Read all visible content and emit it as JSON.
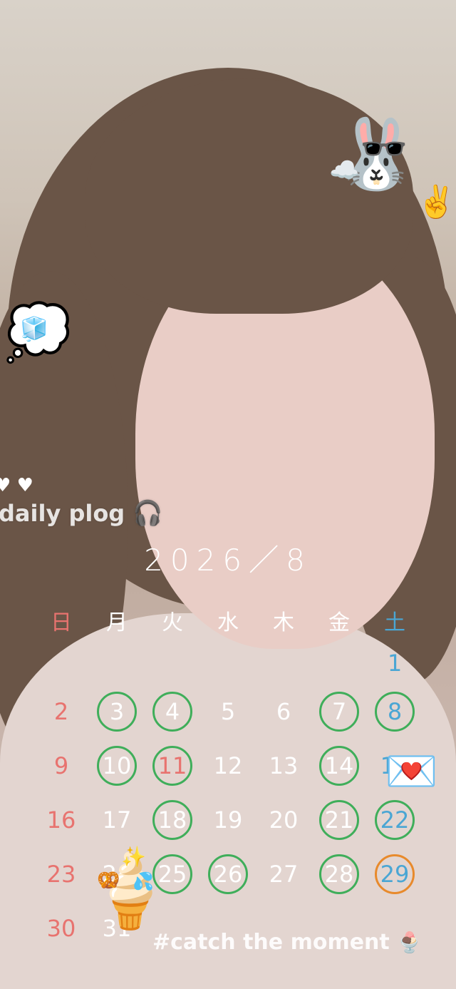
{
  "overlay_text": {
    "plog_label": "daily plog",
    "hashtag": "#catch the moment"
  },
  "calendar": {
    "title": "2026／8",
    "weekdays": [
      "日",
      "月",
      "火",
      "水",
      "木",
      "金",
      "土"
    ],
    "weeks": [
      [
        null,
        null,
        null,
        null,
        null,
        null,
        "1"
      ],
      [
        "2",
        "3",
        "4",
        "5",
        "6",
        "7",
        "8"
      ],
      [
        "9",
        "10",
        "11",
        "12",
        "13",
        "14",
        "15"
      ],
      [
        "16",
        "17",
        "18",
        "19",
        "20",
        "21",
        "22"
      ],
      [
        "23",
        "24",
        "25",
        "26",
        "27",
        "28",
        "29"
      ],
      [
        "30",
        "31",
        null,
        null,
        null,
        null,
        null
      ]
    ],
    "green_circled": [
      "3",
      "4",
      "7",
      "8",
      "10",
      "11",
      "14",
      "18",
      "21",
      "22",
      "25",
      "26",
      "28"
    ],
    "orange_circled": [
      "29"
    ],
    "red_text": [
      "11"
    ],
    "colors": {
      "sunday": "#e8736f",
      "saturday": "#4aa6d4",
      "ring_green": "#3fae5a",
      "ring_orange": "#e88a2c"
    }
  },
  "stickers": [
    "bunny-sunglasses-sticker",
    "thought-bubble-ice-sticker",
    "hearts-sticker",
    "headphones-icon",
    "love-letter-sticker",
    "soft-serve-sticker",
    "parfait-sticker"
  ]
}
